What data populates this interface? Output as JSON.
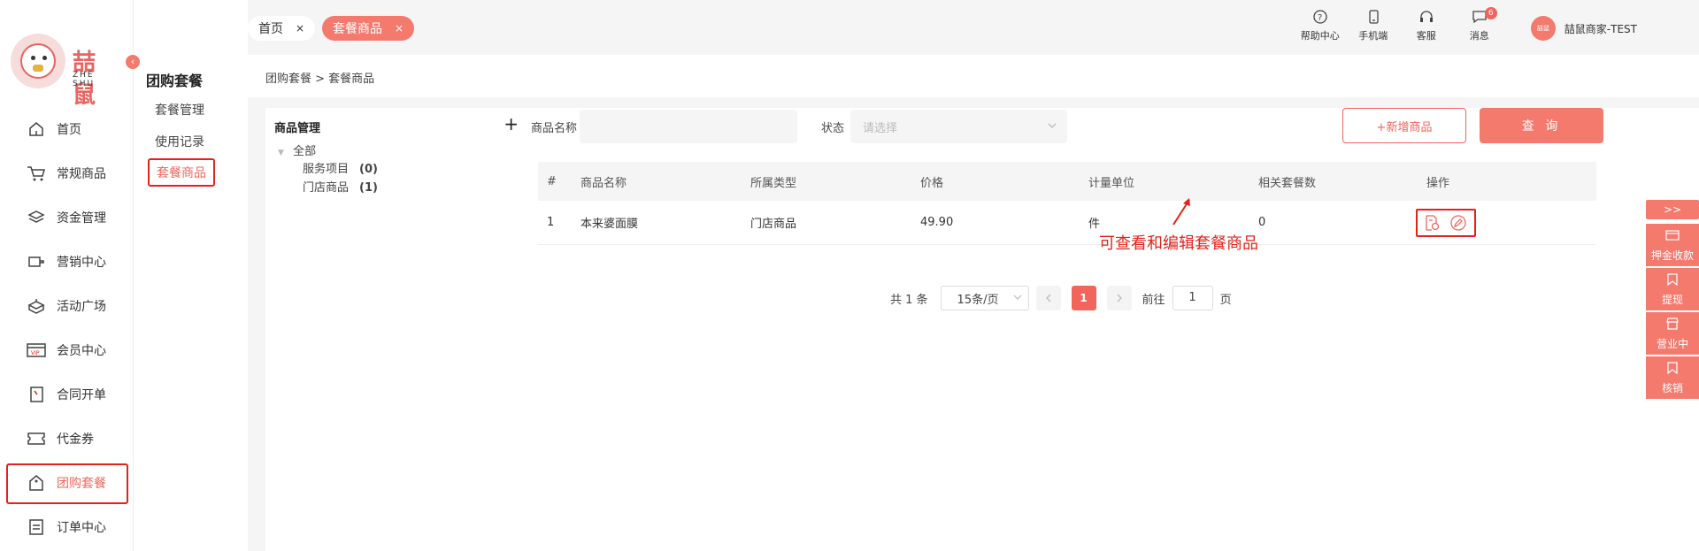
{
  "brand": {
    "logo_text": "喆鼠",
    "logo_sub": "ZHE SHU"
  },
  "nav": {
    "items": [
      {
        "label": "首页",
        "icon": "home-icon"
      },
      {
        "label": "常规商品",
        "icon": "cart-icon"
      },
      {
        "label": "资金管理",
        "icon": "layers-icon"
      },
      {
        "label": "营销中心",
        "icon": "marketing-icon"
      },
      {
        "label": "活动广场",
        "icon": "activity-icon"
      },
      {
        "label": "会员中心",
        "icon": "vip-card-icon"
      },
      {
        "label": "合同开单",
        "icon": "contract-icon"
      },
      {
        "label": "代金券",
        "icon": "voucher-icon"
      },
      {
        "label": "团购套餐",
        "icon": "group-buy-icon",
        "active": true
      },
      {
        "label": "订单中心",
        "icon": "order-icon"
      }
    ]
  },
  "subnav": {
    "title": "团购套餐",
    "items": [
      {
        "label": "套餐管理"
      },
      {
        "label": "使用记录"
      },
      {
        "label": "套餐商品",
        "active": true
      }
    ]
  },
  "tabs": [
    {
      "label": "首页",
      "close": "×"
    },
    {
      "label": "套餐商品",
      "close": "×"
    }
  ],
  "tools": {
    "help": "帮助中心",
    "mobile": "手机端",
    "service": "客服",
    "messages": "消息",
    "message_count": "6",
    "username": "喆鼠商家-TEST",
    "avatar_text": "喆鼠"
  },
  "breadcrumb": "团购套餐  > 套餐商品",
  "tree": {
    "title": "商品管理",
    "add": "+",
    "root": "全部",
    "children": [
      {
        "label": "服务项目",
        "count": "(0)"
      },
      {
        "label": "门店商品",
        "count": "(1)"
      }
    ]
  },
  "filters": {
    "name_label": "商品名称",
    "name_value": "",
    "status_label": "状态",
    "status_placeholder": "请选择",
    "add_button": "+新增商品",
    "query_button": "查 询"
  },
  "table": {
    "headers": [
      "#",
      "商品名称",
      "所属类型",
      "价格",
      "计量单位",
      "相关套餐数",
      "操作"
    ],
    "rows": [
      {
        "index": "1",
        "name": "本来婆面膜",
        "type": "门店商品",
        "price": "49.90",
        "unit": "件",
        "package_count": "0"
      }
    ]
  },
  "pager": {
    "total": "共 1 条",
    "page_size": "15条/页",
    "current": "1",
    "goto_label": "前往",
    "goto_value": "1",
    "page_suffix": "页"
  },
  "annotation": "可查看和编辑套餐商品",
  "right_float": {
    "toggle": ">>",
    "items": [
      {
        "label": "押金收款"
      },
      {
        "label": "提现"
      },
      {
        "label": "营业中"
      },
      {
        "label": "核销"
      }
    ]
  },
  "colors": {
    "accent": "#f1655c",
    "accent_light": "#f47a6e",
    "highlight_frame": "#e2231a"
  }
}
